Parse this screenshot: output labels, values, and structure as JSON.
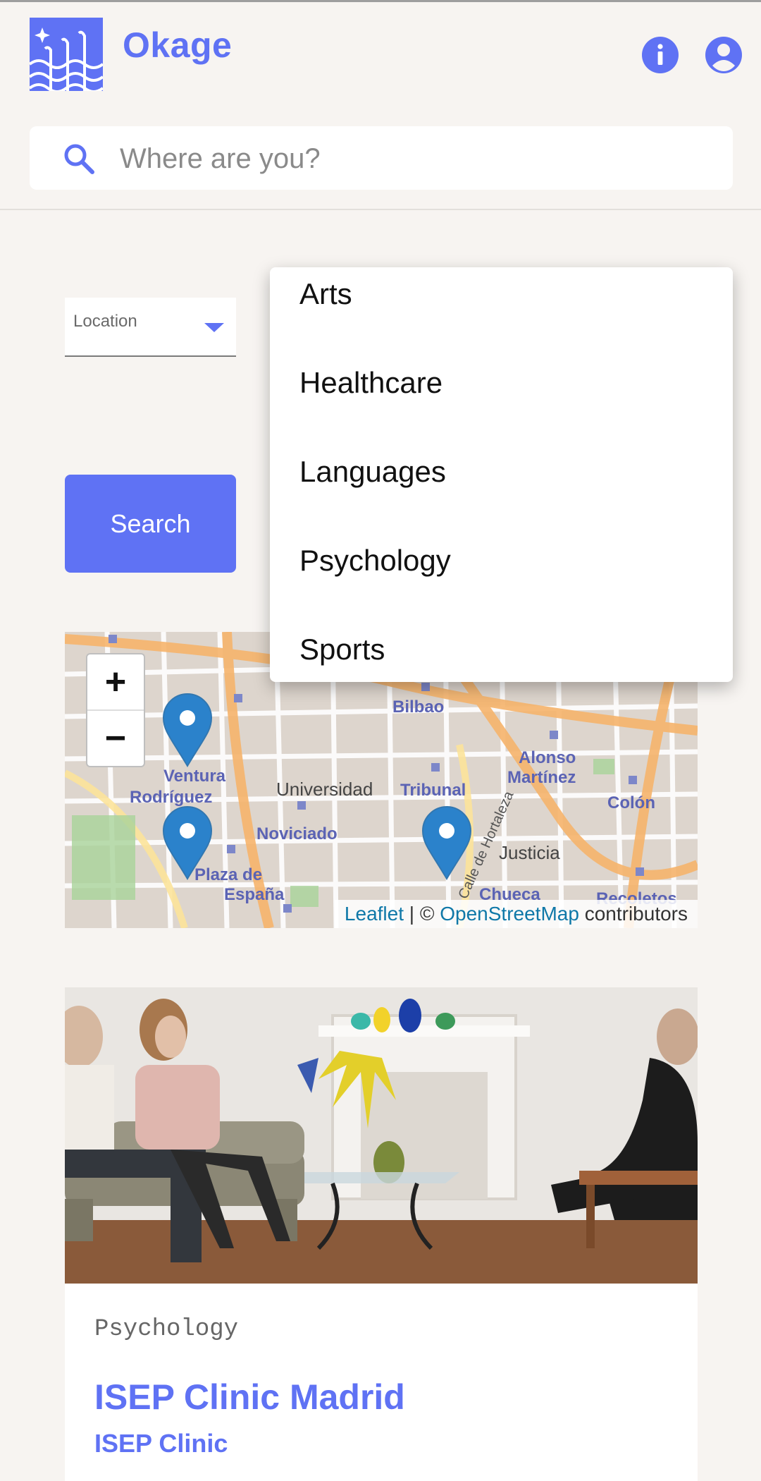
{
  "app": {
    "name": "Okage",
    "accent_color": "#5f72f4"
  },
  "header": {
    "icons": [
      "waves-logo-icon",
      "info-icon",
      "account-circle-icon"
    ]
  },
  "search": {
    "placeholder": "Where are you?",
    "value": ""
  },
  "filters": {
    "location_label": "Location",
    "search_button": "Search"
  },
  "category_dropdown": {
    "open": true,
    "options": [
      "Arts",
      "Healthcare",
      "Languages",
      "Psychology",
      "Sports"
    ]
  },
  "map": {
    "zoom_in": "+",
    "zoom_out": "−",
    "labels": [
      "Bilbao",
      "Alonso Martínez",
      "Ventura Rodríguez",
      "Universidad",
      "Tribunal",
      "Colón",
      "Noviciado",
      "Justicia",
      "Plaza de España",
      "Chueca",
      "Recoletos",
      "Calle de Hortaleza"
    ],
    "attribution": {
      "leaflet": "Leaflet",
      "separator": " | © ",
      "osm": "OpenStreetMap",
      "suffix": " contributors"
    },
    "marker_count": 3
  },
  "card": {
    "category": "Psychology",
    "title": "ISEP Clinic Madrid",
    "subtitle": "ISEP Clinic"
  }
}
